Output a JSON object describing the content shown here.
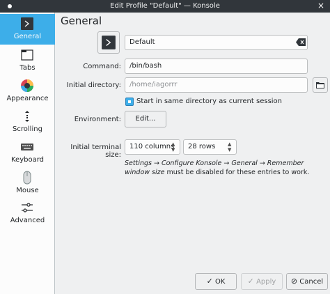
{
  "window": {
    "title": "Edit Profile \"Default\" — Konsole",
    "close_glyph": "×"
  },
  "sidebar": {
    "items": [
      {
        "label": "General",
        "icon": "terminal-icon",
        "active": true
      },
      {
        "label": "Tabs",
        "icon": "tabs-icon"
      },
      {
        "label": "Appearance",
        "icon": "color-wheel-icon"
      },
      {
        "label": "Scrolling",
        "icon": "scroll-arrows-icon"
      },
      {
        "label": "Keyboard",
        "icon": "keyboard-icon"
      },
      {
        "label": "Mouse",
        "icon": "mouse-icon"
      },
      {
        "label": "Advanced",
        "icon": "sliders-icon"
      }
    ]
  },
  "general": {
    "title": "General",
    "profile_name": "Default",
    "command_label": "Command:",
    "command_value": "/bin/bash",
    "initial_dir_label": "Initial directory:",
    "initial_dir_placeholder": "/home/iagorrr",
    "same_dir_checkbox": {
      "label": "Start in same directory as current session",
      "checked": true
    },
    "environment_label": "Environment:",
    "environment_button": "Edit...",
    "terminal_size_label": "Initial terminal size:",
    "columns_value": "110 columns",
    "rows_value": "28 rows",
    "note_path": "Settings → Configure Konsole → General → Remember window size",
    "note_rest": " must be disabled for these entries to work."
  },
  "footer": {
    "ok": "OK",
    "apply": "Apply",
    "cancel": "Cancel"
  },
  "colors": {
    "accent": "#3daee9",
    "titlebar": "#31363b",
    "sidebar": "#fcfcfc",
    "window": "#eff0f1"
  }
}
